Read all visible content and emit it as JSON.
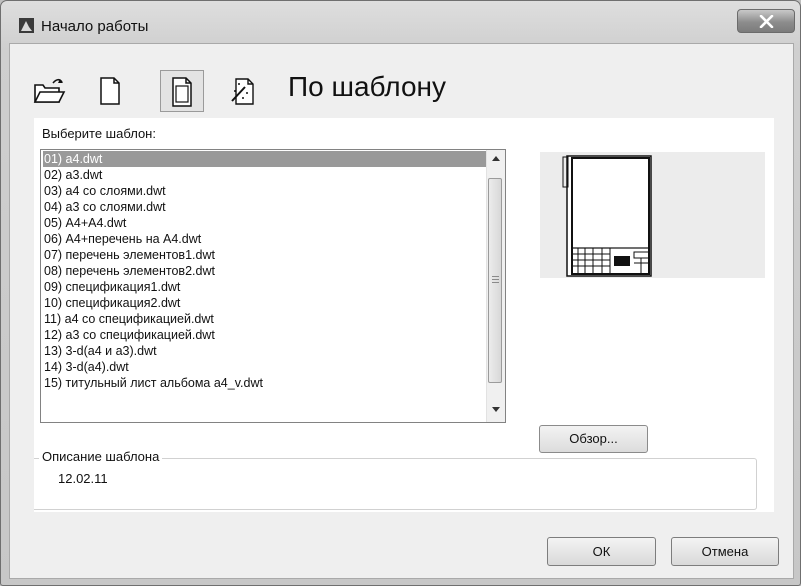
{
  "window": {
    "title": "Начало работы"
  },
  "toolbar": {
    "icons": [
      "open-folder-icon",
      "blank-drawing-icon",
      "template-icon",
      "wizard-icon"
    ],
    "active": "template-icon",
    "heading": "По шаблону"
  },
  "template_list": {
    "prompt": "Выберите шаблон:",
    "items": [
      "01) a4.dwt",
      "02) a3.dwt",
      "03) a4 со слоями.dwt",
      "04) a3 со слоями.dwt",
      "05) А4+А4.dwt",
      "06) А4+перечень на  А4.dwt",
      "07) перечень элементов1.dwt",
      "08) перечень элементов2.dwt",
      "09) спецификация1.dwt",
      "10) спецификация2.dwt",
      "11) a4  со спецификацией.dwt",
      "12) a3  со спецификацией.dwt",
      "13) 3-d(a4 и a3).dwt",
      "14) 3-d(a4).dwt",
      "15) титульный лист альбома a4_v.dwt"
    ],
    "selected_index": 0
  },
  "browse_label": "Обзор...",
  "description": {
    "label": "Описание шаблона",
    "text": "12.02.11"
  },
  "buttons": {
    "ok": "ОК",
    "cancel": "Отмена"
  }
}
